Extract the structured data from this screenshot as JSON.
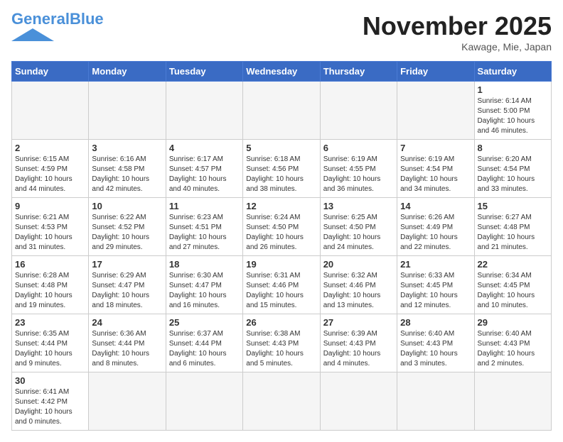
{
  "header": {
    "logo_general": "General",
    "logo_blue": "Blue",
    "month_title": "November 2025",
    "location": "Kawage, Mie, Japan"
  },
  "weekdays": [
    "Sunday",
    "Monday",
    "Tuesday",
    "Wednesday",
    "Thursday",
    "Friday",
    "Saturday"
  ],
  "weeks": [
    [
      {
        "day": "",
        "info": ""
      },
      {
        "day": "",
        "info": ""
      },
      {
        "day": "",
        "info": ""
      },
      {
        "day": "",
        "info": ""
      },
      {
        "day": "",
        "info": ""
      },
      {
        "day": "",
        "info": ""
      },
      {
        "day": "1",
        "info": "Sunrise: 6:14 AM\nSunset: 5:00 PM\nDaylight: 10 hours and 46 minutes."
      }
    ],
    [
      {
        "day": "2",
        "info": "Sunrise: 6:15 AM\nSunset: 4:59 PM\nDaylight: 10 hours and 44 minutes."
      },
      {
        "day": "3",
        "info": "Sunrise: 6:16 AM\nSunset: 4:58 PM\nDaylight: 10 hours and 42 minutes."
      },
      {
        "day": "4",
        "info": "Sunrise: 6:17 AM\nSunset: 4:57 PM\nDaylight: 10 hours and 40 minutes."
      },
      {
        "day": "5",
        "info": "Sunrise: 6:18 AM\nSunset: 4:56 PM\nDaylight: 10 hours and 38 minutes."
      },
      {
        "day": "6",
        "info": "Sunrise: 6:19 AM\nSunset: 4:55 PM\nDaylight: 10 hours and 36 minutes."
      },
      {
        "day": "7",
        "info": "Sunrise: 6:19 AM\nSunset: 4:54 PM\nDaylight: 10 hours and 34 minutes."
      },
      {
        "day": "8",
        "info": "Sunrise: 6:20 AM\nSunset: 4:54 PM\nDaylight: 10 hours and 33 minutes."
      }
    ],
    [
      {
        "day": "9",
        "info": "Sunrise: 6:21 AM\nSunset: 4:53 PM\nDaylight: 10 hours and 31 minutes."
      },
      {
        "day": "10",
        "info": "Sunrise: 6:22 AM\nSunset: 4:52 PM\nDaylight: 10 hours and 29 minutes."
      },
      {
        "day": "11",
        "info": "Sunrise: 6:23 AM\nSunset: 4:51 PM\nDaylight: 10 hours and 27 minutes."
      },
      {
        "day": "12",
        "info": "Sunrise: 6:24 AM\nSunset: 4:50 PM\nDaylight: 10 hours and 26 minutes."
      },
      {
        "day": "13",
        "info": "Sunrise: 6:25 AM\nSunset: 4:50 PM\nDaylight: 10 hours and 24 minutes."
      },
      {
        "day": "14",
        "info": "Sunrise: 6:26 AM\nSunset: 4:49 PM\nDaylight: 10 hours and 22 minutes."
      },
      {
        "day": "15",
        "info": "Sunrise: 6:27 AM\nSunset: 4:48 PM\nDaylight: 10 hours and 21 minutes."
      }
    ],
    [
      {
        "day": "16",
        "info": "Sunrise: 6:28 AM\nSunset: 4:48 PM\nDaylight: 10 hours and 19 minutes."
      },
      {
        "day": "17",
        "info": "Sunrise: 6:29 AM\nSunset: 4:47 PM\nDaylight: 10 hours and 18 minutes."
      },
      {
        "day": "18",
        "info": "Sunrise: 6:30 AM\nSunset: 4:47 PM\nDaylight: 10 hours and 16 minutes."
      },
      {
        "day": "19",
        "info": "Sunrise: 6:31 AM\nSunset: 4:46 PM\nDaylight: 10 hours and 15 minutes."
      },
      {
        "day": "20",
        "info": "Sunrise: 6:32 AM\nSunset: 4:46 PM\nDaylight: 10 hours and 13 minutes."
      },
      {
        "day": "21",
        "info": "Sunrise: 6:33 AM\nSunset: 4:45 PM\nDaylight: 10 hours and 12 minutes."
      },
      {
        "day": "22",
        "info": "Sunrise: 6:34 AM\nSunset: 4:45 PM\nDaylight: 10 hours and 10 minutes."
      }
    ],
    [
      {
        "day": "23",
        "info": "Sunrise: 6:35 AM\nSunset: 4:44 PM\nDaylight: 10 hours and 9 minutes."
      },
      {
        "day": "24",
        "info": "Sunrise: 6:36 AM\nSunset: 4:44 PM\nDaylight: 10 hours and 8 minutes."
      },
      {
        "day": "25",
        "info": "Sunrise: 6:37 AM\nSunset: 4:44 PM\nDaylight: 10 hours and 6 minutes."
      },
      {
        "day": "26",
        "info": "Sunrise: 6:38 AM\nSunset: 4:43 PM\nDaylight: 10 hours and 5 minutes."
      },
      {
        "day": "27",
        "info": "Sunrise: 6:39 AM\nSunset: 4:43 PM\nDaylight: 10 hours and 4 minutes."
      },
      {
        "day": "28",
        "info": "Sunrise: 6:40 AM\nSunset: 4:43 PM\nDaylight: 10 hours and 3 minutes."
      },
      {
        "day": "29",
        "info": "Sunrise: 6:40 AM\nSunset: 4:43 PM\nDaylight: 10 hours and 2 minutes."
      }
    ],
    [
      {
        "day": "30",
        "info": "Sunrise: 6:41 AM\nSunset: 4:42 PM\nDaylight: 10 hours and 0 minutes."
      },
      {
        "day": "",
        "info": ""
      },
      {
        "day": "",
        "info": ""
      },
      {
        "day": "",
        "info": ""
      },
      {
        "day": "",
        "info": ""
      },
      {
        "day": "",
        "info": ""
      },
      {
        "day": "",
        "info": ""
      }
    ]
  ]
}
